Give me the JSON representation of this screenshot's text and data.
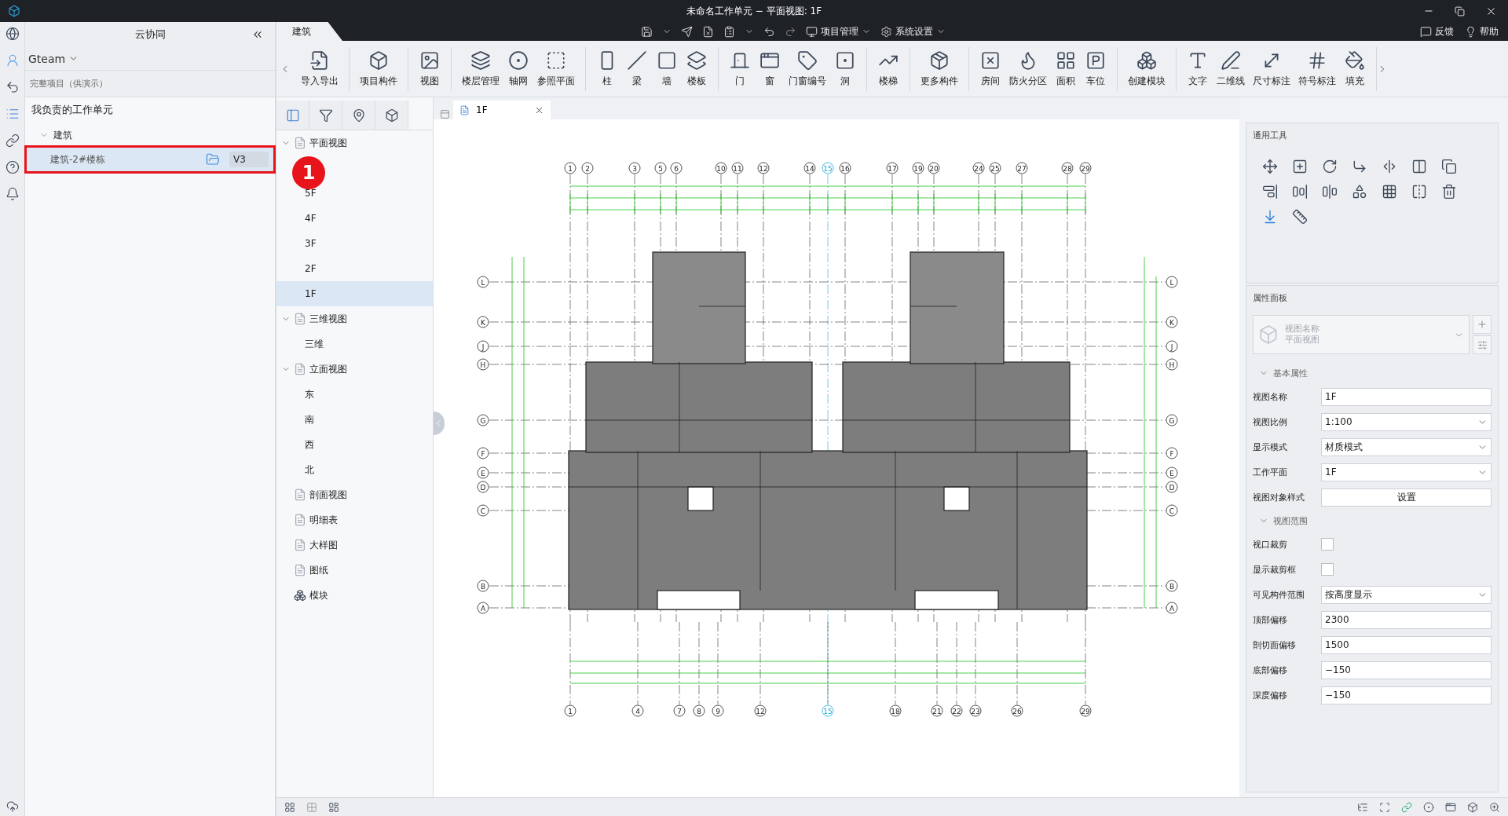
{
  "window": {
    "title": "未命名工作单元 − 平面视图: 1F"
  },
  "quick_toolbar": {
    "menus": [
      "项目管理",
      "系统设置"
    ]
  },
  "help_links": [
    "反馈",
    "帮助"
  ],
  "sidebar": {
    "title": "云协同",
    "user": "Gteam",
    "project": "完整项目（供演示）",
    "section": "我负责的工作单元",
    "tree": [
      {
        "label": "建筑",
        "expanded": true,
        "children": [
          {
            "label": "建筑-2#楼栋",
            "version": "V3",
            "selected": true,
            "highlighted": true
          }
        ]
      }
    ]
  },
  "annotation": {
    "number": "1"
  },
  "ribbon": {
    "tabs": [
      {
        "label": "建筑",
        "selected": true
      }
    ],
    "groups": [
      [
        "导入导出"
      ],
      [
        "项目构件"
      ],
      [
        "视图"
      ],
      [
        "楼层管理",
        "轴网",
        "参照平面"
      ],
      [
        "柱",
        "梁",
        "墙",
        "楼板"
      ],
      [
        "门",
        "窗",
        "门窗编号",
        "洞"
      ],
      [
        "楼梯"
      ],
      [
        "更多构件"
      ],
      [
        "房间",
        "防火分区",
        "面积",
        "车位"
      ],
      [
        "创建模块"
      ],
      [
        "文字",
        "二维线",
        "尺寸标注",
        "符号标注",
        "填充"
      ]
    ]
  },
  "view_tree": [
    {
      "label": "平面视图",
      "expanded": true,
      "children": [
        {
          "label": "5F",
          "selected": false
        },
        {
          "label": "4F",
          "selected": false
        },
        {
          "label": "3F",
          "selected": false
        },
        {
          "label": "2F",
          "selected": false
        },
        {
          "label": "1F",
          "selected": true
        }
      ]
    },
    {
      "label": "三维视图",
      "expanded": true,
      "children": [
        {
          "label": "三维",
          "selected": false
        }
      ]
    },
    {
      "label": "立面视图",
      "expanded": true,
      "children": [
        {
          "label": "东",
          "selected": false
        },
        {
          "label": "南",
          "selected": false
        },
        {
          "label": "西",
          "selected": false
        },
        {
          "label": "北",
          "selected": false
        }
      ]
    },
    {
      "label": "剖面视图"
    },
    {
      "label": "明细表"
    },
    {
      "label": "大样图"
    },
    {
      "label": "图纸"
    },
    {
      "label": "模块"
    }
  ],
  "canvas": {
    "tabs": [
      {
        "label": "1F",
        "selected": true
      }
    ],
    "top_axes": [
      "1",
      "2",
      "3",
      "5",
      "6",
      "10",
      "11",
      "12",
      "14",
      "15",
      "16",
      "17",
      "19",
      "20",
      "24",
      "25",
      "27",
      "28",
      "29"
    ],
    "bottom_axes": [
      "1",
      "4",
      "7",
      "8",
      "9",
      "12",
      "15",
      "18",
      "21",
      "22",
      "23",
      "26",
      "29"
    ],
    "left_axes": [
      "L",
      "K",
      "J",
      "H",
      "G",
      "F",
      "E",
      "D",
      "C",
      "B",
      "A"
    ],
    "right_axes": [
      "L",
      "K",
      "J",
      "H",
      "G",
      "F",
      "E",
      "D",
      "C",
      "B",
      "A"
    ]
  },
  "properties": {
    "tools_title": "通用工具",
    "title": "属性面板",
    "type_label": "视图名称",
    "type_value": "平面视图",
    "sections": [
      {
        "title": "基本属性",
        "expanded": true,
        "rows": [
          {
            "label": "视图名称",
            "kind": "text",
            "value": "1F"
          },
          {
            "label": "视图比例",
            "kind": "select",
            "value": "1:100"
          },
          {
            "label": "显示模式",
            "kind": "select",
            "value": "材质模式"
          },
          {
            "label": "工作平面",
            "kind": "select",
            "value": "1F"
          },
          {
            "label": "视图对象样式",
            "kind": "button",
            "value": "设置"
          }
        ]
      },
      {
        "title": "视图范围",
        "expanded": true,
        "rows": [
          {
            "label": "视口裁剪",
            "kind": "checkbox",
            "checked": false
          },
          {
            "label": "显示裁剪框",
            "kind": "checkbox",
            "checked": false
          },
          {
            "label": "可见构件范围",
            "kind": "select",
            "value": "按高度显示"
          },
          {
            "label": "顶部偏移",
            "kind": "text",
            "value": "2300"
          },
          {
            "label": "剖切面偏移",
            "kind": "text",
            "value": "1500"
          },
          {
            "label": "底部偏移",
            "kind": "text",
            "value": "−150"
          },
          {
            "label": "深度偏移",
            "kind": "text",
            "value": "−150"
          }
        ]
      }
    ]
  }
}
